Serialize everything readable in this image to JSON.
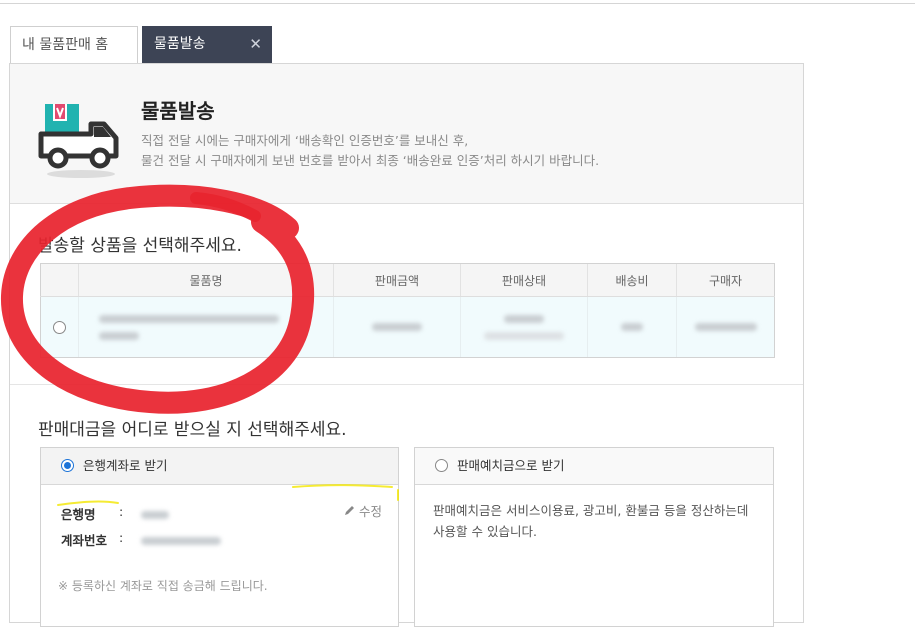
{
  "tabs": {
    "home_label": "내 물품판매 홈",
    "active_label": "물품발송",
    "close_glyph": "✕"
  },
  "header": {
    "title": "물품발송",
    "desc_line1": "직접 전달 시에는 구매자에게 ‘배송확인 인증번호’를 보내신 후,",
    "desc_line2": "물건 전달 시 구매자에게 보낸 번호를 받아서 최종 ‘배송완료 인증’처리 하시기 바랍니다."
  },
  "product_section": {
    "title": "발송할 상품을 선택해주세요.",
    "columns": [
      "",
      "물품명",
      "판매금액",
      "판매상태",
      "배송비",
      "구매자"
    ]
  },
  "payout_section": {
    "title": "판매대금을 어디로 받으실 지 선택해주세요.",
    "bank_option": {
      "label": "은행계좌로 받기",
      "bank_label": "은행명",
      "account_label": "계좌번호",
      "colon": ":",
      "edit_label": "수정",
      "note": "※ 등록하신 계좌로 직접 송금해 드립니다."
    },
    "deposit_option": {
      "label": "판매예치금으로 받기",
      "desc": "판매예치금은 서비스이용료, 광고비, 환불금 등을 정산하는데 사용할 수 있습니다."
    }
  },
  "colors": {
    "active_tab": "#3d4455",
    "selected_row": "#f1fbfd",
    "radio_accent": "#1d74d8",
    "annotation_red": "#e8242e",
    "truck_teal": "#21b3b0",
    "truck_pink": "#e24a6f"
  },
  "icons": {
    "header_icon": "delivery-truck-icon",
    "edit_icon": "pencil-icon",
    "close_icon": "close-icon"
  }
}
